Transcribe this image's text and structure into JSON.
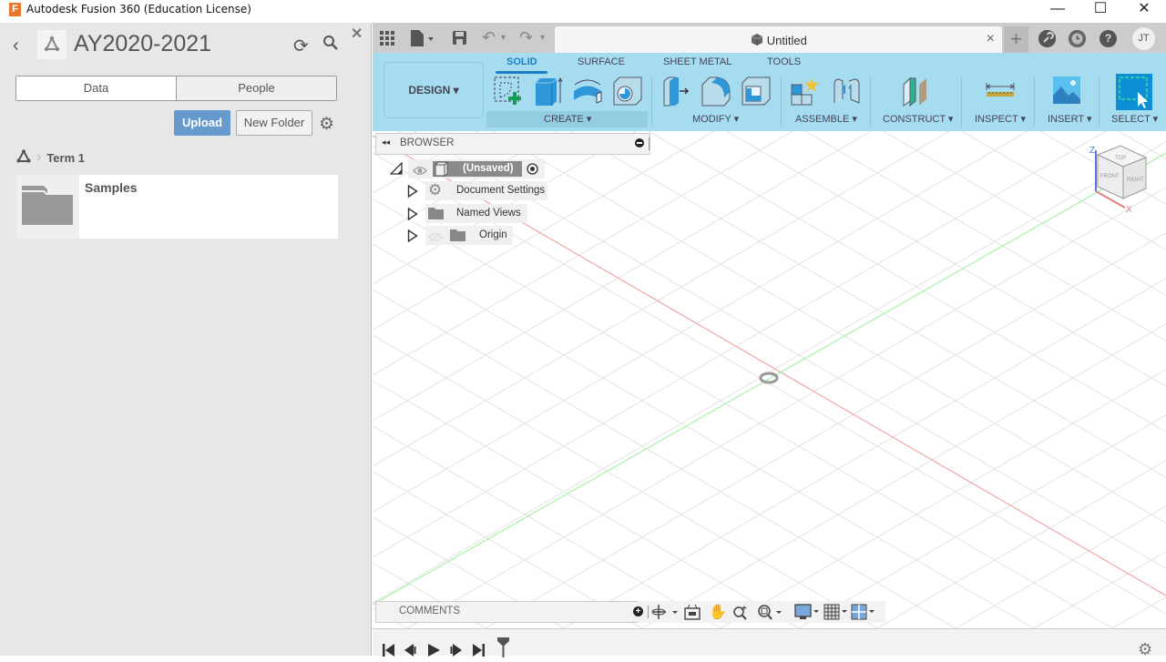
{
  "window": {
    "title": "Autodesk Fusion 360 (Education License)",
    "logo_letter": "F",
    "minimize": "—",
    "maximize": "☐",
    "close": "✕"
  },
  "data_panel": {
    "back_icon": "‹",
    "project_title": "AY2020-2021",
    "refresh_icon": "⟳",
    "close_icon": "✕",
    "tabs": [
      {
        "label": "Data",
        "active": true
      },
      {
        "label": "People",
        "active": false
      }
    ],
    "upload_label": "Upload",
    "new_folder_label": "New Folder",
    "settings_icon": "⚙",
    "breadcrumb": {
      "separator": "›",
      "current": "Term 1"
    },
    "folders": [
      {
        "name": "Samples"
      }
    ]
  },
  "toolbar": {
    "grid_icon": "grid-icon",
    "file_icon": "file-icon",
    "save_icon": "save-icon",
    "undo_icon": "↶",
    "redo_icon": "↷",
    "dropdown": "▾",
    "document_tab": {
      "title": "Untitled",
      "close": "×"
    },
    "new_tab": "+",
    "help_icons": [
      "job-status-icon",
      "recent-icon",
      "help-icon"
    ],
    "help_label": "?",
    "user_initials": "JT"
  },
  "ribbon": {
    "workspace": "DESIGN ▾",
    "tabs": [
      {
        "label": "SOLID",
        "active": true
      },
      {
        "label": "SURFACE",
        "active": false
      },
      {
        "label": "SHEET METAL",
        "active": false
      },
      {
        "label": "TOOLS",
        "active": false
      }
    ],
    "groups": [
      {
        "label": "CREATE ▾",
        "tools": [
          "create-sketch",
          "extrude",
          "revolve",
          "hole"
        ]
      },
      {
        "label": "MODIFY ▾",
        "tools": [
          "press-pull",
          "fillet",
          "shell"
        ]
      },
      {
        "label": "ASSEMBLE ▾",
        "tools": [
          "new-component",
          "joint"
        ]
      },
      {
        "label": "CONSTRUCT ▾",
        "tools": [
          "offset-plane"
        ]
      },
      {
        "label": "INSPECT ▾",
        "tools": [
          "measure"
        ]
      },
      {
        "label": "INSERT ▾",
        "tools": [
          "insert-image"
        ]
      },
      {
        "label": "SELECT ▾",
        "tools": [
          "select"
        ]
      }
    ],
    "colors": {
      "background": "#a5dcf0",
      "active_tab": "#1a7fc4"
    }
  },
  "browser": {
    "title": "BROWSER",
    "collapse_icon": "◂◂",
    "root": {
      "label": "(Unsaved)"
    },
    "items": [
      {
        "label": "Document Settings",
        "icon": "gear"
      },
      {
        "label": "Named Views",
        "icon": "folder"
      },
      {
        "label": "Origin",
        "icon": "folder",
        "hidden": true
      }
    ]
  },
  "viewcube": {
    "top": "TOP",
    "front": "FRONT",
    "right": "RIGHT",
    "axis_z": "Z",
    "axis_x": "X"
  },
  "comments": {
    "label": "COMMENTS",
    "add_icon": "+"
  },
  "nav_bar": {
    "tools": [
      "orbit",
      "look-at",
      "pan",
      "zoom",
      "fit",
      "display-settings",
      "grid-settings",
      "viewports"
    ]
  },
  "timeline": {
    "controls": [
      "go-to-start",
      "step-back",
      "play",
      "step-forward",
      "go-to-end"
    ]
  }
}
